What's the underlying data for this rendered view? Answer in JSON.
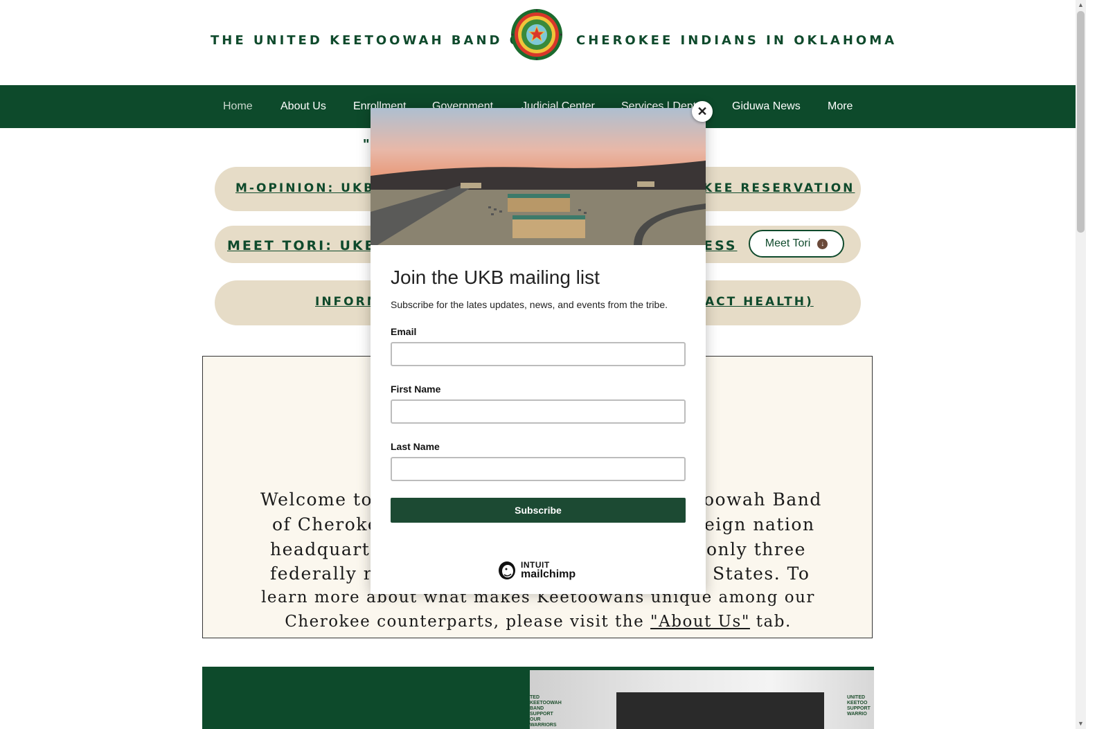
{
  "header": {
    "title_left": "THE UNITED KEETOOWAH BAND OF",
    "title_right": "CHEROKEE INDIANS IN OKLAHOMA",
    "seal_icon": "ukb-seal-icon"
  },
  "nav": {
    "items": [
      {
        "label": "Home"
      },
      {
        "label": "About Us"
      },
      {
        "label": "Enrollment"
      },
      {
        "label": "Government"
      },
      {
        "label": "Judicial Center"
      },
      {
        "label": "Services | Dept"
      },
      {
        "label": "Giduwa News"
      },
      {
        "label": "More"
      }
    ]
  },
  "main": {
    "tagline": "\"",
    "pills": [
      {
        "left_text": "M-OPINION: UKB",
        "right_text": "KEE RESERVATION"
      },
      {
        "left_text": "MEET TORI: UKE",
        "right_text": "ESS",
        "button": "Meet Tori"
      },
      {
        "left_text": "INFORM",
        "right_text": "ACT HEALTH)"
      }
    ],
    "welcome_lines": [
      {
        "left": "Welcome to",
        "right": "oowah Band"
      },
      {
        "left": "of Cherokee",
        "right": "eign nation"
      },
      {
        "left": "headquarter",
        "right": "only three"
      },
      {
        "left": "federally re",
        "right": "States. To"
      },
      {
        "full": "learn more about what makes Keetoowahs unique among our"
      },
      {
        "pre": "Cherokee counterparts, please visit the ",
        "link": "\"About Us\"",
        "post": " tab."
      }
    ],
    "photo_sign_left": "TED KEETOOWAH BAND SUPPORT OUR WARRIORS",
    "photo_sign_right": "UNITED KEETOO SUPPORT WARRIO"
  },
  "modal": {
    "title": "Join the UKB mailing list",
    "subtitle": "Subscribe for the lates updates, news, and events from the tribe.",
    "fields": [
      {
        "label": "Email",
        "value": "",
        "placeholder": ""
      },
      {
        "label": "First Name",
        "value": "",
        "placeholder": ""
      },
      {
        "label": "Last Name",
        "value": "",
        "placeholder": ""
      }
    ],
    "subscribe_label": "Subscribe",
    "brand_intuit": "INTUIT",
    "brand_name": "mailchimp",
    "close_glyph": "✕"
  },
  "colors": {
    "brand_green": "#0d4a2b",
    "pill_bg": "#e6dcc7",
    "welcome_bg": "#fbf7ee",
    "subscribe_bg": "#1c4a33"
  }
}
